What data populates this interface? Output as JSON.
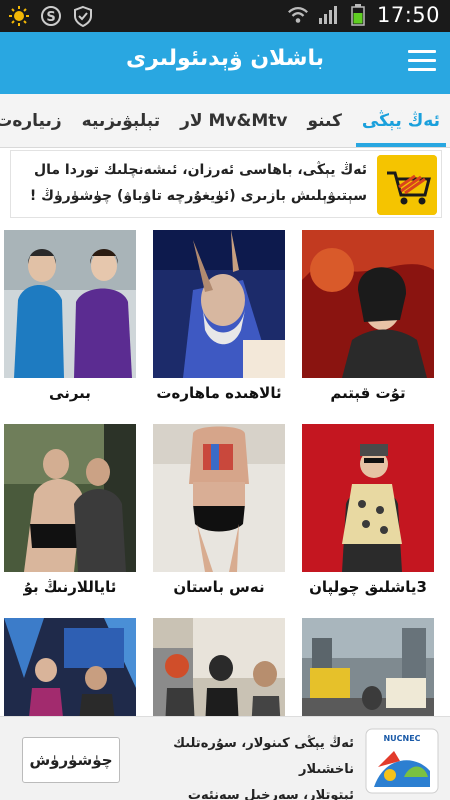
{
  "status_bar": {
    "time": "17:50",
    "icons": [
      "sun-icon",
      "s-circle-icon",
      "shield-icon",
      "wifi-icon",
      "signal-icon",
      "battery-icon"
    ]
  },
  "app": {
    "title": "باشلان ۋېدىئولىرى",
    "menu_icon": "hamburger-icon",
    "accent": "#29a7e1"
  },
  "tabs": [
    {
      "label": "ئەڭ يېڭى",
      "active": true
    },
    {
      "label": "كىنو",
      "active": false
    },
    {
      "label": "Mv&Mtv لار",
      "active": false
    },
    {
      "label": "تېلېۋىزىيە",
      "active": false
    },
    {
      "label": "زىيارەت",
      "active": false
    }
  ],
  "promo": {
    "line1": "ئەڭ يېڭى، باھاسى ئەرزان، ئىشەنچلىك توردا مال",
    "line2": "سېتىۋېلىش بازىرى (ئۈيغۇرچە تاۋباۋ) چۈشۈرۈڭ !",
    "icon": "shopping-cart-icon"
  },
  "videos": [
    {
      "caption": "تۇت قېتىم"
    },
    {
      "caption": "ئالاھىدە ماھارەت"
    },
    {
      "caption": "بىرنى"
    },
    {
      "caption": "3ياشلىق چولپان"
    },
    {
      "caption": "نەس باستان"
    },
    {
      "caption": "ئاياللارنىڭ بۇ"
    },
    {
      "caption": ""
    },
    {
      "caption": ""
    },
    {
      "caption": ""
    }
  ],
  "bottom_ad": {
    "line1": "ئەڭ يېڭى كىنولار، سۇرەتلىك ناخشىلار",
    "line2": "ئېتوتلار، سەرخىل سەنئەت نومۇرلىرى",
    "button": "چۈشۈرۈش",
    "logo_text": "NUCNEC"
  }
}
